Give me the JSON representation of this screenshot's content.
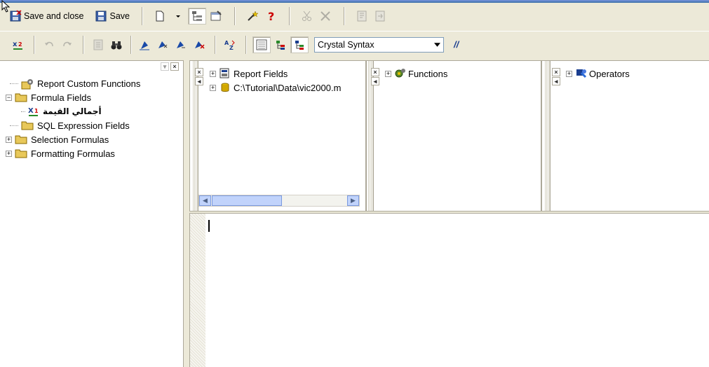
{
  "toolbar1": {
    "save_and_close_label": "Save and close",
    "save_label": "Save"
  },
  "toolbar2": {
    "syntax_select": "Crystal Syntax",
    "comment_label": "//"
  },
  "tree": {
    "items": [
      {
        "label": "Report Custom Functions"
      },
      {
        "label": "Formula Fields"
      },
      {
        "label": "أجمالي القيمة"
      },
      {
        "label": "SQL Expression Fields"
      },
      {
        "label": "Selection Formulas"
      },
      {
        "label": "Formatting Formulas"
      }
    ]
  },
  "fields_pane": {
    "root_label": "Report Fields",
    "db_label": "C:\\Tutorial\\Data\\vic2000.m"
  },
  "functions_pane": {
    "root_label": "Functions"
  },
  "operators_pane": {
    "root_label": "Operators"
  },
  "icons": {
    "x2": "x-sub-2-icon",
    "x1": "x-sub-1-icon"
  }
}
